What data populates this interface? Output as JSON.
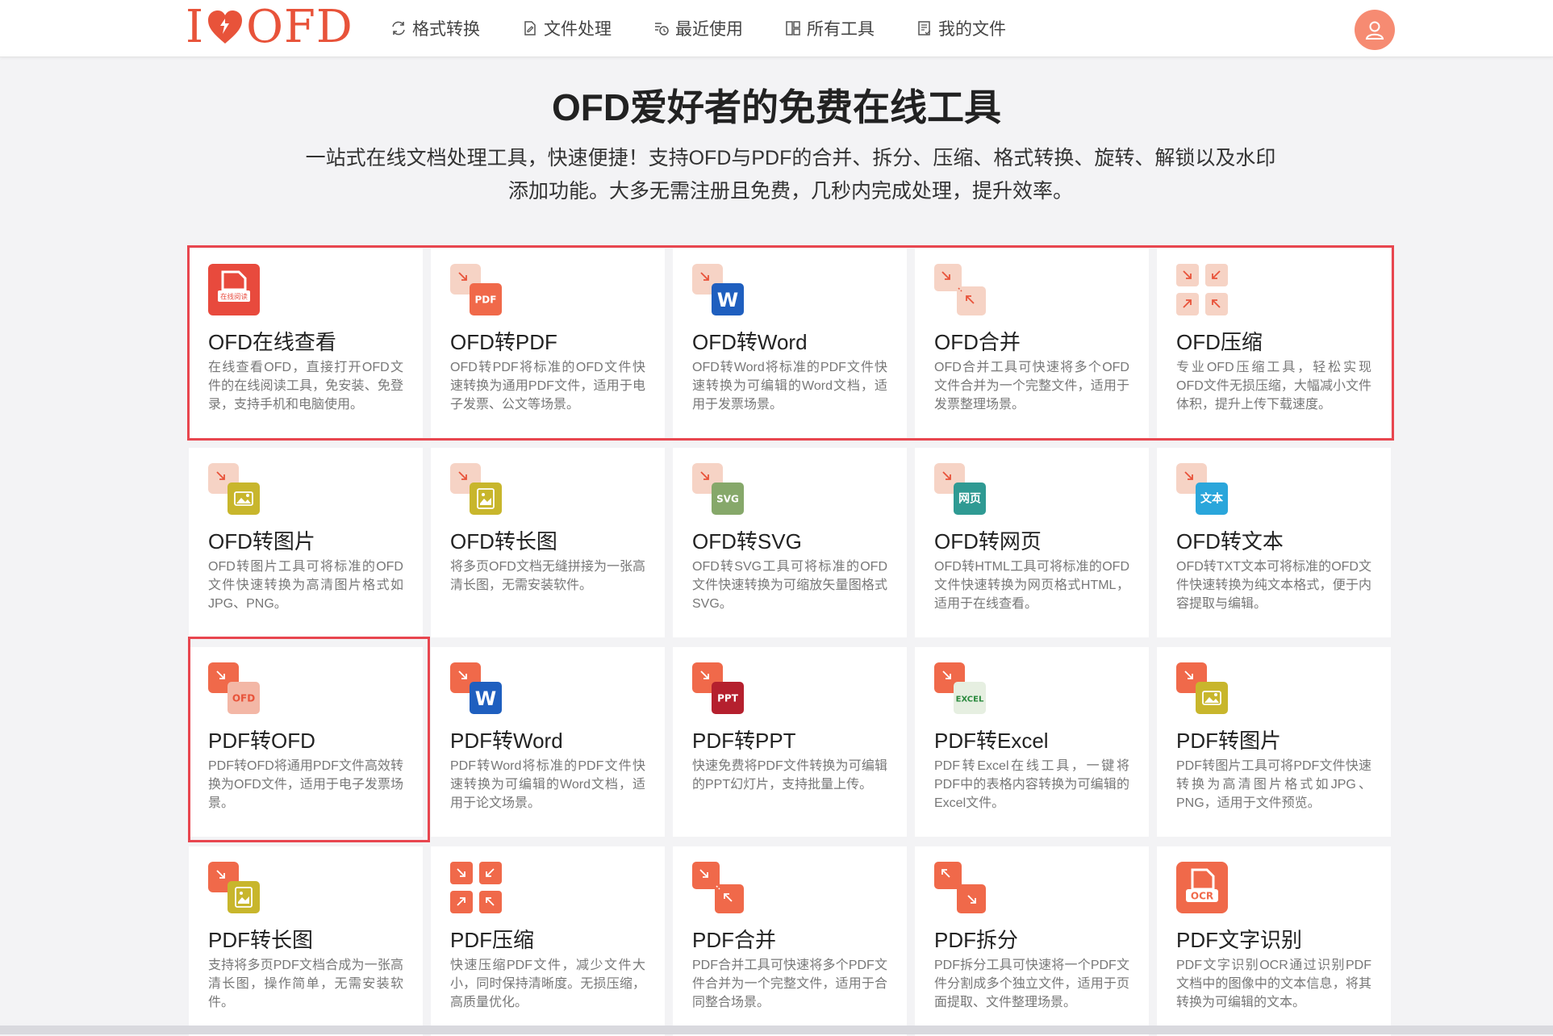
{
  "header": {
    "logo_text_left": "I",
    "logo_text_right": "OFD",
    "nav": [
      {
        "label": "格式转换",
        "icon": "convert-icon"
      },
      {
        "label": "文件处理",
        "icon": "file-edit-icon"
      },
      {
        "label": "最近使用",
        "icon": "recent-icon"
      },
      {
        "label": "所有工具",
        "icon": "grid-icon"
      },
      {
        "label": "我的文件",
        "icon": "my-files-icon"
      }
    ],
    "avatar_icon": "user-icon"
  },
  "hero": {
    "title": "OFD爱好者的免费在线工具",
    "subtitle_line1": "一站式在线文档处理工具，快速便捷！支持OFD与PDF的合并、拆分、压缩、格式转换、旋转、解锁以及水印",
    "subtitle_line2": "添加功能。大多无需注册且免费，几秒内完成处理，提升效率。"
  },
  "colors": {
    "accent": "#e8533a",
    "highlight": "#e8464f",
    "card_bg": "#ffffff",
    "page_bg": "#f3f3f5"
  },
  "tools": [
    {
      "title": "OFD在线查看",
      "desc": "在线查看OFD，直接打开OFD文件的在线阅读工具，免安装、免登录，支持手机和电脑使用。",
      "icon": "ofd-viewer-icon",
      "badge": "在线阅读",
      "color": "#e84a3d"
    },
    {
      "title": "OFD转PDF",
      "desc": "OFD转PDF将标准的OFD文件快速转换为通用PDF文件，适用于电子发票、公文等场景。",
      "icon": "ofd-to-pdf-icon",
      "badge": "PDF",
      "color": "#f0694a"
    },
    {
      "title": "OFD转Word",
      "desc": "OFD转Word将标准的PDF文件快速转换为可编辑的Word文档，适用于发票场景。",
      "icon": "ofd-to-word-icon",
      "badge": "W",
      "color": "#1f5fbf"
    },
    {
      "title": "OFD合并",
      "desc": "OFD合并工具可快速将多个OFD文件合并为一个完整文件，适用于发票整理场景。",
      "icon": "ofd-merge-icon",
      "badge": "",
      "color": "#f2c1b0"
    },
    {
      "title": "OFD压缩",
      "desc": "专业OFD压缩工具，轻松实现OFD文件无损压缩，大幅减小文件体积，提升上传下载速度。",
      "icon": "ofd-compress-icon",
      "badge": "",
      "color": "#f2c1b0"
    },
    {
      "title": "OFD转图片",
      "desc": "OFD转图片工具可将标准的OFD文件快速转换为高清图片格式如JPG、PNG。",
      "icon": "ofd-to-image-icon",
      "badge": "",
      "color": "#c8b62c"
    },
    {
      "title": "OFD转长图",
      "desc": "将多页OFD文档无缝拼接为一张高清长图，无需安装软件。",
      "icon": "ofd-to-long-image-icon",
      "badge": "",
      "color": "#c8b62c"
    },
    {
      "title": "OFD转SVG",
      "desc": "OFD转SVG工具可将标准的OFD文件快速转换为可缩放矢量图格式SVG。",
      "icon": "ofd-to-svg-icon",
      "badge": "SVG",
      "color": "#86a86a"
    },
    {
      "title": "OFD转网页",
      "desc": "OFD转HTML工具可将标准的OFD文件快速转换为网页格式HTML，适用于在线查看。",
      "icon": "ofd-to-html-icon",
      "badge": "网页",
      "color": "#2f9a93"
    },
    {
      "title": "OFD转文本",
      "desc": "OFD转TXT文本可将标准的OFD文件快速转换为纯文本格式，便于内容提取与编辑。",
      "icon": "ofd-to-text-icon",
      "badge": "文本",
      "color": "#2aa6db"
    },
    {
      "title": "PDF转OFD",
      "desc": "PDF转OFD将通用PDF文件高效转换为OFD文件，适用于电子发票场景。",
      "icon": "pdf-to-ofd-icon",
      "badge": "OFD",
      "color": "#f3b7a6"
    },
    {
      "title": "PDF转Word",
      "desc": "PDF转Word将标准的PDF文件快速转换为可编辑的Word文档，适用于论文场景。",
      "icon": "pdf-to-word-icon",
      "badge": "W",
      "color": "#1f5fbf"
    },
    {
      "title": "PDF转PPT",
      "desc": "快速免费将PDF文件转换为可编辑的PPT幻灯片，支持批量上传。",
      "icon": "pdf-to-ppt-icon",
      "badge": "PPT",
      "color": "#b5202e"
    },
    {
      "title": "PDF转Excel",
      "desc": "PDF转Excel在线工具，一键将PDF中的表格内容转换为可编辑的Excel文件。",
      "icon": "pdf-to-excel-icon",
      "badge": "EXCEL",
      "color": "#e6efe1"
    },
    {
      "title": "PDF转图片",
      "desc": "PDF转图片工具可将PDF文件快速转换为高清图片格式如JPG、PNG，适用于文件预览。",
      "icon": "pdf-to-image-icon",
      "badge": "",
      "color": "#c8b62c"
    },
    {
      "title": "PDF转长图",
      "desc": "支持将多页PDF文档合成为一张高清长图，操作简单，无需安装软件。",
      "icon": "pdf-to-long-image-icon",
      "badge": "",
      "color": "#c8b62c"
    },
    {
      "title": "PDF压缩",
      "desc": "快速压缩PDF文件，减少文件大小，同时保持清晰度。无损压缩，高质量优化。",
      "icon": "pdf-compress-icon",
      "badge": "",
      "color": "#f0694a"
    },
    {
      "title": "PDF合并",
      "desc": "PDF合并工具可快速将多个PDF文件合并为一个完整文件，适用于合同整合场景。",
      "icon": "pdf-merge-icon",
      "badge": "",
      "color": "#f0694a"
    },
    {
      "title": "PDF拆分",
      "desc": "PDF拆分工具可快速将一个PDF文件分割成多个独立文件，适用于页面提取、文件整理场景。",
      "icon": "pdf-split-icon",
      "badge": "",
      "color": "#f0694a"
    },
    {
      "title": "PDF文字识别",
      "desc": "PDF文字识别OCR通过识别PDF文档中的图像中的文本信息，将其转换为可编辑的文本。",
      "icon": "pdf-ocr-icon",
      "badge": "OCR",
      "color": "#f0694a"
    }
  ]
}
